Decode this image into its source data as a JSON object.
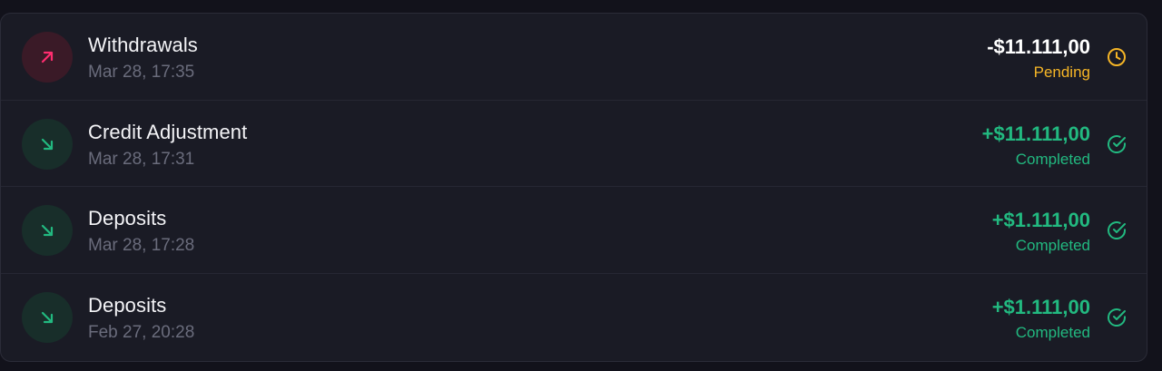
{
  "colors": {
    "pending": "#f5b526",
    "completed": "#22b980",
    "outgoing": "#ff2d6f",
    "incoming": "#22b980"
  },
  "transactions": [
    {
      "title": "Withdrawals",
      "date": "Mar 28, 17:35",
      "amount": "-$11.111,00",
      "status": "Pending",
      "direction_icon": "arrow-up-right-icon",
      "status_icon": "clock-icon"
    },
    {
      "title": "Credit Adjustment",
      "date": "Mar 28, 17:31",
      "amount": "+$11.111,00",
      "status": "Completed",
      "direction_icon": "arrow-down-right-icon",
      "status_icon": "check-circle-icon"
    },
    {
      "title": "Deposits",
      "date": "Mar 28, 17:28",
      "amount": "+$1.111,00",
      "status": "Completed",
      "direction_icon": "arrow-down-right-icon",
      "status_icon": "check-circle-icon"
    },
    {
      "title": "Deposits",
      "date": "Feb 27, 20:28",
      "amount": "+$1.111,00",
      "status": "Completed",
      "direction_icon": "arrow-down-right-icon",
      "status_icon": "check-circle-icon"
    }
  ]
}
